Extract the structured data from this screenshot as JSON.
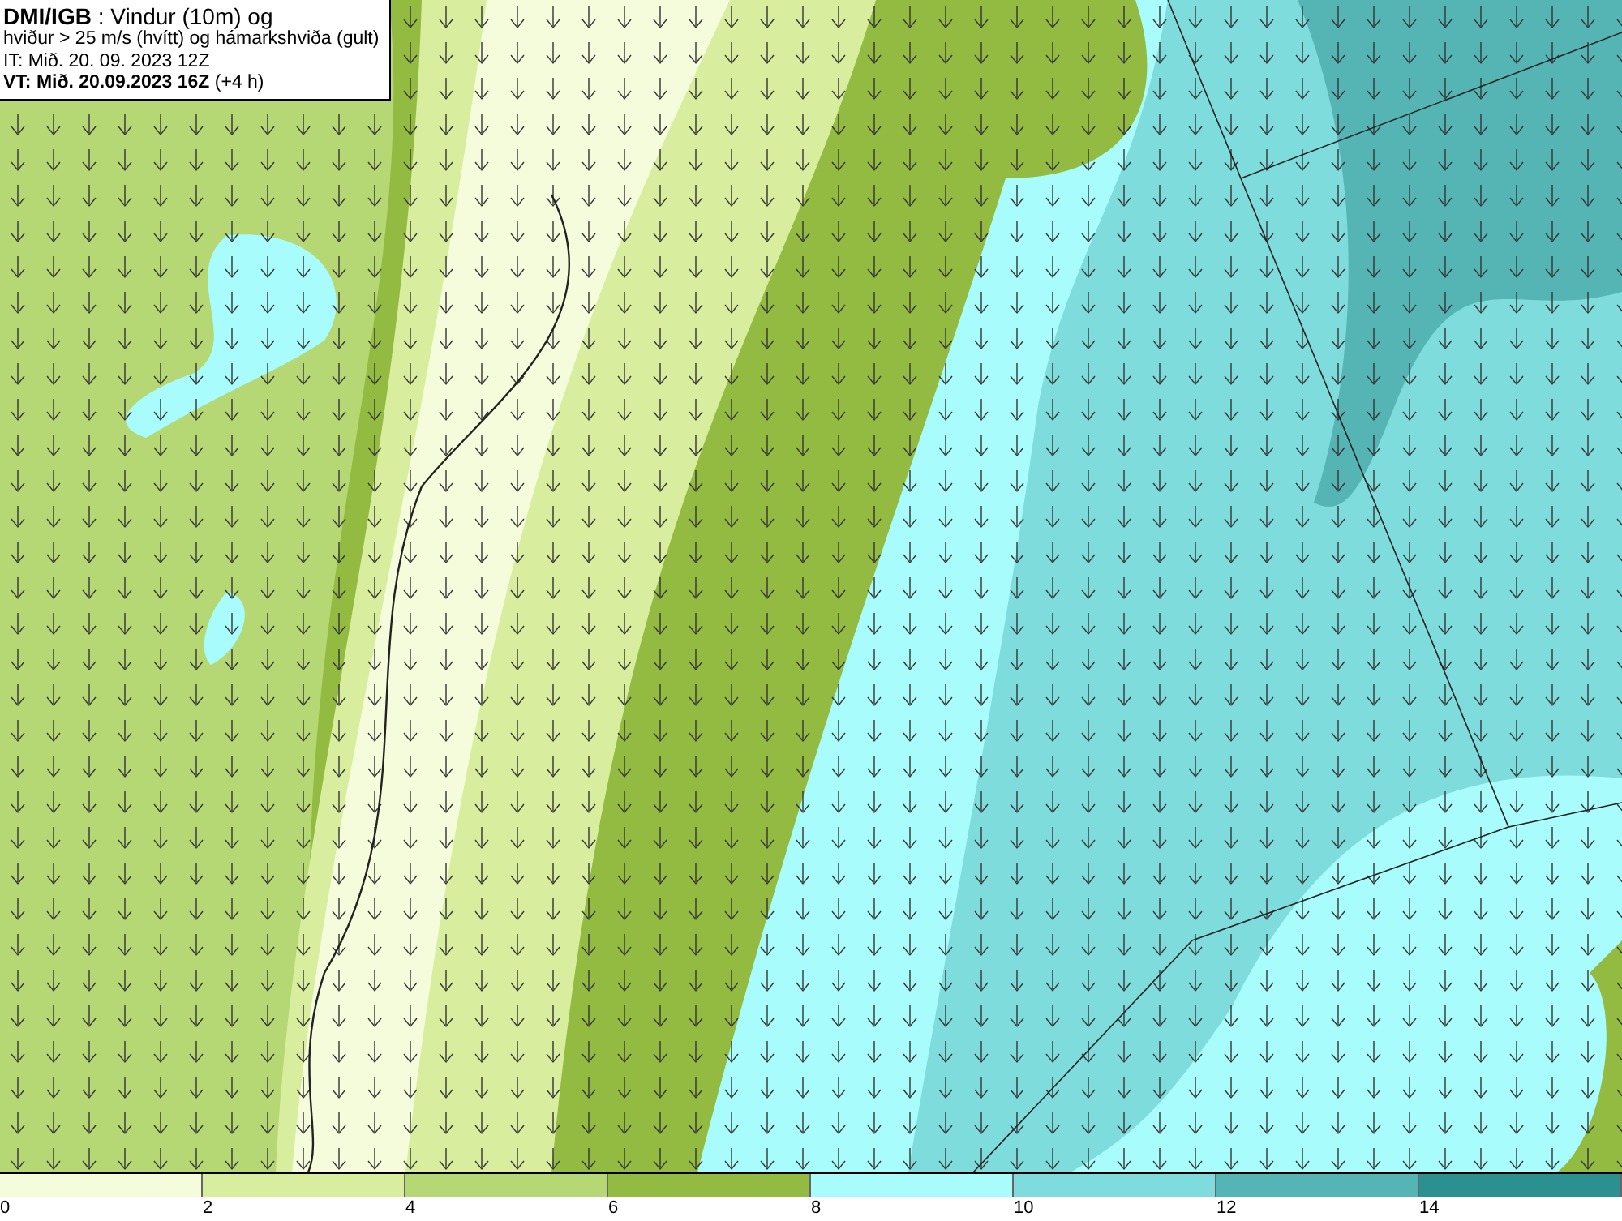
{
  "title_box": {
    "lines": [
      "**DMI/IGB** : Vindur (10m) og",
      "hviður > 25 m/s (hvítt) og hámarkshviða (gult)",
      "IT: Mið. 20. 09. 2023 12Z",
      "**VT: Mið. 20.09.2023 16Z** (+4 h)"
    ]
  },
  "legend": {
    "bins": [
      {
        "color": "#f5fcdc"
      },
      {
        "color": "#d8ee9e"
      },
      {
        "color": "#b5d874"
      },
      {
        "color": "#93bb41"
      },
      {
        "color": "#a8fcfc"
      },
      {
        "color": "#7fdcdc"
      },
      {
        "color": "#55b5b5"
      },
      {
        "color": "#2a9090"
      }
    ],
    "ticks": [
      "0",
      "2",
      "4",
      "6",
      "8",
      "10",
      "12",
      "14"
    ]
  }
}
